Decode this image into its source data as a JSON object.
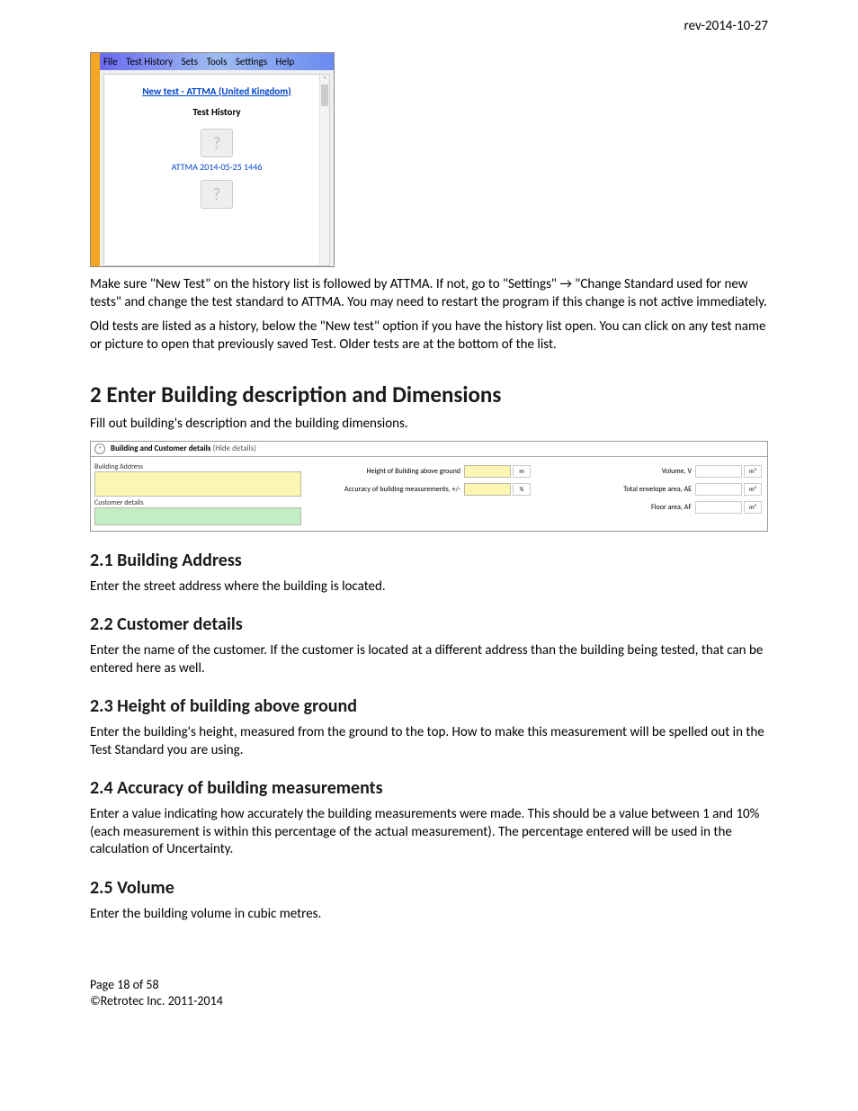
{
  "header": {
    "revision": "rev-2014-10-27"
  },
  "screenshot1": {
    "menu": {
      "file": "File",
      "testhistory": "Test History",
      "sets": "Sets",
      "tools": "Tools",
      "settings": "Settings",
      "help": "Help"
    },
    "newtest": "New test - ATTMA (United Kingdom)",
    "historyLabel": "Test History",
    "histItem": "ATTMA 2014-05-25 1446"
  },
  "para1": "Make sure \"New Test\" on the history list is followed by ATTMA.  If not, go to \"Settings\"  →  \"Change Standard used for new tests\" and change the test standard to ATTMA.  You may need to restart the program if this change is not active immediately.",
  "para2": "Old tests are listed as a history, below the \"New test\" option if you have the history list open.  You can click on any test name or picture to open that previously saved Test.  Older tests are at the bottom of the list.",
  "h1": "2   Enter Building description and Dimensions",
  "h1_sub": "Fill out building's description and the building dimensions.",
  "formpanel": {
    "header": "Building and Customer details",
    "hide": "(Hide details)",
    "buildingAddress": "Building Address",
    "customerDetails": "Customer details",
    "height": "Height of Building above ground",
    "heightUnit": "m",
    "accuracy": "Accuracy of building measurements, +/-",
    "accuracyUnit": "%",
    "volume": "Volume, V",
    "volumeUnit": "m³",
    "envelope": "Total envelope area, AE",
    "envelopeUnit": "m²",
    "floor": "Floor area, AF",
    "floorUnit": "m²"
  },
  "s21": {
    "h": "2.1  Building Address",
    "p": "Enter the street address where the building is located."
  },
  "s22": {
    "h": "2.2  Customer details",
    "p": "Enter the name of the customer.   If the customer is located at a different address than the building being tested, that can be entered here as well."
  },
  "s23": {
    "h": "2.3  Height of building above ground",
    "p": "Enter the building's height, measured from the ground to the top.  How to make this measurement will be spelled out in the Test Standard you are using."
  },
  "s24": {
    "h": "2.4  Accuracy of building measurements",
    "p": "Enter a value indicating how accurately the building measurements were made.  This should be a value between 1 and 10% (each measurement is within this percentage of the actual measurement).  The percentage entered will be used in the calculation of Uncertainty."
  },
  "s25": {
    "h": "2.5  Volume",
    "p": "Enter the building volume in cubic metres."
  },
  "footer": {
    "page": "Page 18 of 58",
    "copyright": "©Retrotec Inc. 2011-2014"
  }
}
